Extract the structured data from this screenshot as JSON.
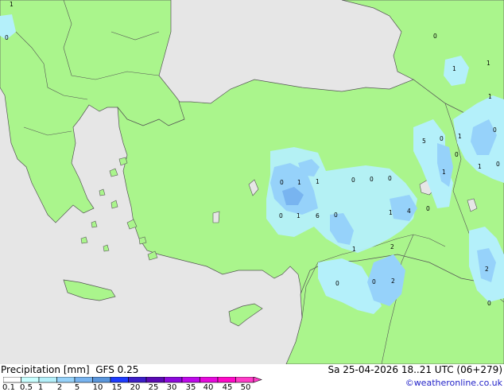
{
  "title": "Precipitation [mm]",
  "model": "GFS 0.25",
  "datetime": "Sa 25-04-2026 18..21 UTC (06+279)",
  "credit": "©weatheronline.co.uk",
  "colors": {
    "sea": "#e6e6e6",
    "land": "#aaf58c",
    "border": "#555555",
    "precip_light": "#b4f0fa",
    "precip_mid": "#96d2fa",
    "precip_heavy": "#78b4f0"
  },
  "legend": {
    "labels": [
      "0.1",
      "0.5",
      "1",
      "2",
      "5",
      "10",
      "15",
      "20",
      "25",
      "30",
      "35",
      "40",
      "45",
      "50"
    ],
    "colors": [
      "#ffffff",
      "#c8ffff",
      "#b4f0fa",
      "#96d2fa",
      "#78b4f0",
      "#5a96dc",
      "#1e3cff",
      "#3c1ec8",
      "#5a0ab4",
      "#8c0adc",
      "#be0aeb",
      "#e60adc",
      "#ff0ac8",
      "#ff3cc8"
    ]
  },
  "map_values": [
    {
      "label": "1"
    },
    {
      "label": "0"
    },
    {
      "label": "0"
    },
    {
      "label": "1"
    },
    {
      "label": "1"
    },
    {
      "label": "1"
    },
    {
      "label": "0"
    },
    {
      "label": "5"
    },
    {
      "label": "0"
    },
    {
      "label": "1"
    },
    {
      "label": "0"
    },
    {
      "label": "1"
    },
    {
      "label": "1"
    },
    {
      "label": "0"
    },
    {
      "label": "0"
    },
    {
      "label": "1"
    },
    {
      "label": "1"
    },
    {
      "label": "0"
    },
    {
      "label": "0"
    },
    {
      "label": "0"
    },
    {
      "label": "0"
    },
    {
      "label": "1"
    },
    {
      "label": "6"
    },
    {
      "label": "0"
    },
    {
      "label": "1"
    },
    {
      "label": "4"
    },
    {
      "label": "0"
    },
    {
      "label": "1"
    },
    {
      "label": "2"
    },
    {
      "label": "0"
    },
    {
      "label": "0"
    },
    {
      "label": "2"
    },
    {
      "label": "2"
    },
    {
      "label": "0"
    }
  ]
}
